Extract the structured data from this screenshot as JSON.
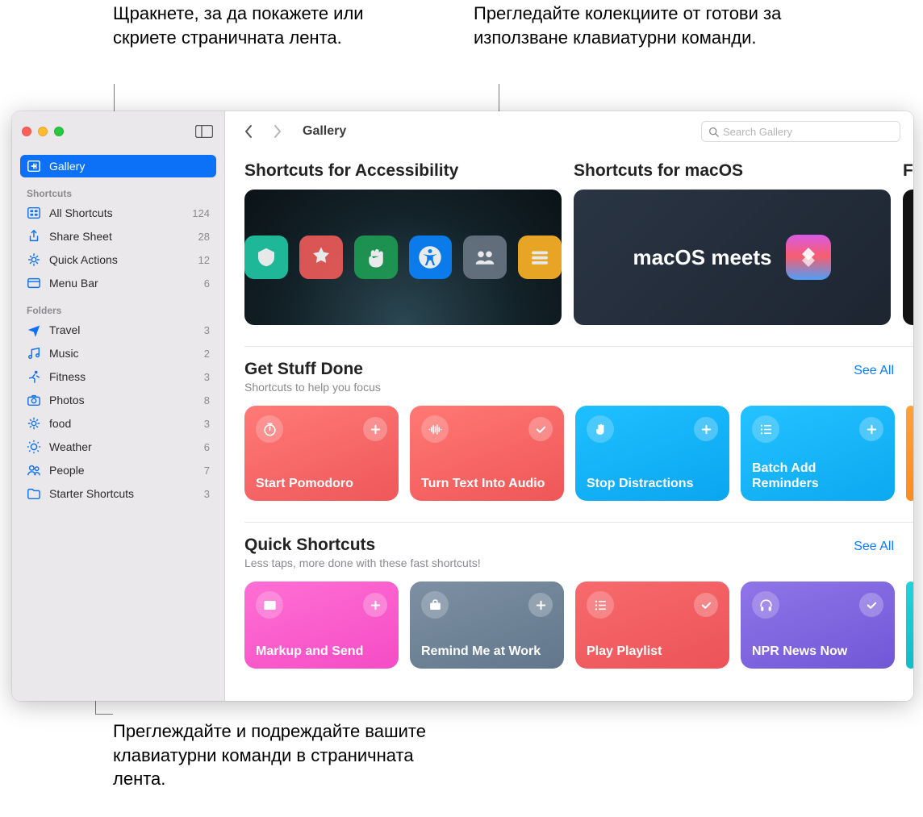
{
  "annotations": {
    "topLeft": "Щракнете, за да покажете или скриете страничната лента.",
    "topRight": "Прегледайте колекциите от готови за използване клавиатурни команди.",
    "bottom": "Преглеждайте и подреждайте вашите клавиатурни команди в страничната лента."
  },
  "sidebar": {
    "gallery": "Gallery",
    "shortcutsLabel": "Shortcuts",
    "foldersLabel": "Folders",
    "shortcuts": [
      {
        "label": "All Shortcuts",
        "count": "124",
        "icon": "grid"
      },
      {
        "label": "Share Sheet",
        "count": "28",
        "icon": "share"
      },
      {
        "label": "Quick Actions",
        "count": "12",
        "icon": "gear"
      },
      {
        "label": "Menu Bar",
        "count": "6",
        "icon": "menubar"
      }
    ],
    "folders": [
      {
        "label": "Travel",
        "count": "3",
        "icon": "plane"
      },
      {
        "label": "Music",
        "count": "2",
        "icon": "music"
      },
      {
        "label": "Fitness",
        "count": "3",
        "icon": "runner"
      },
      {
        "label": "Photos",
        "count": "8",
        "icon": "camera"
      },
      {
        "label": "food",
        "count": "3",
        "icon": "burst"
      },
      {
        "label": "Weather",
        "count": "6",
        "icon": "sun"
      },
      {
        "label": "People",
        "count": "7",
        "icon": "people"
      },
      {
        "label": "Starter Shortcuts",
        "count": "3",
        "icon": "folder"
      }
    ]
  },
  "toolbar": {
    "title": "Gallery",
    "searchPlaceholder": "Search Gallery"
  },
  "heroes": {
    "acc": "Shortcuts for Accessibility",
    "mac": "Shortcuts for macOS",
    "macText": "macOS meets",
    "cut": "F"
  },
  "sections": {
    "getStuff": {
      "title": "Get Stuff Done",
      "sub": "Shortcuts to help you focus",
      "seeAll": "See All",
      "cards": [
        {
          "label": "Start Pomodoro",
          "color": "c-red1",
          "icon": "timer",
          "action": "plus"
        },
        {
          "label": "Turn Text Into Audio",
          "color": "c-red2",
          "icon": "wave",
          "action": "check"
        },
        {
          "label": "Stop Distractions",
          "color": "c-blue",
          "icon": "hand",
          "action": "plus"
        },
        {
          "label": "Batch Add Reminders",
          "color": "c-blue2",
          "icon": "list",
          "action": "plus"
        }
      ]
    },
    "quick": {
      "title": "Quick Shortcuts",
      "sub": "Less taps, more done with these fast shortcuts!",
      "seeAll": "See All",
      "cards": [
        {
          "label": "Markup and Send",
          "color": "c-pink",
          "icon": "image",
          "action": "plus"
        },
        {
          "label": "Remind Me at Work",
          "color": "c-slate",
          "icon": "briefcase",
          "action": "plus"
        },
        {
          "label": "Play Playlist",
          "color": "c-redflat",
          "icon": "list",
          "action": "check"
        },
        {
          "label": "NPR News Now",
          "color": "c-purple",
          "icon": "headphones",
          "action": "check"
        }
      ]
    }
  }
}
